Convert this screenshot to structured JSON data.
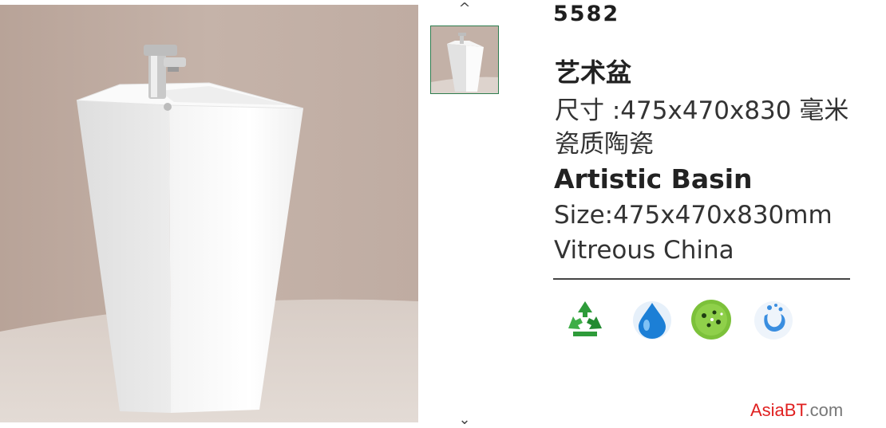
{
  "product": {
    "model_number": "5582",
    "cn_title": "艺术盆",
    "cn_size": "尺寸 :475x470x830 毫米",
    "cn_material": "瓷质陶瓷",
    "en_title": "Artistic Basin",
    "en_size": "Size:475x470x830mm",
    "en_material": "Vitreous China"
  },
  "gallery": {
    "prev_arrow": "^",
    "next_arrow": "⌄"
  },
  "features": [
    {
      "icon": "recycle-icon",
      "color": "#2e9b3a"
    },
    {
      "icon": "water-drop-icon",
      "color": "#1c7fd6"
    },
    {
      "icon": "antibacterial-icon",
      "color": "#7cc13a"
    },
    {
      "icon": "water-splash-icon",
      "color": "#3a8ee0"
    }
  ],
  "watermark": {
    "brand": "AsiaBT",
    "domain": ".com",
    "brand_color": "#e02020"
  }
}
